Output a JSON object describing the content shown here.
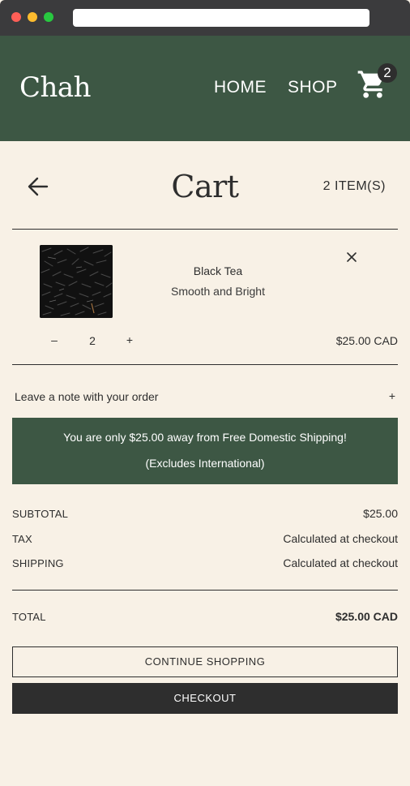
{
  "header": {
    "logo": "Chah",
    "nav": [
      "HOME",
      "SHOP"
    ],
    "cart_count": "2",
    "colors": {
      "header_bg": "#3d5744",
      "page_bg": "#f8f1e6",
      "dark": "#2e2e2e"
    }
  },
  "cart": {
    "title": "Cart",
    "item_count_label": "2 ITEM(S)",
    "icons": {
      "back": "arrow-left-icon",
      "cart": "shopping-cart-icon",
      "remove": "close-icon"
    }
  },
  "items": [
    {
      "name": "Black Tea",
      "subtitle": "Smooth and Bright",
      "quantity": "2",
      "minus": "–",
      "plus": "+",
      "price": "$25.00 CAD"
    }
  ],
  "note": {
    "label": "Leave a note with your order",
    "toggle": "+"
  },
  "shipping_banner": {
    "line1": "You are only $25.00 away from Free Domestic Shipping!",
    "line2": "(Excludes International)"
  },
  "summary": {
    "subtotal_label": "SUBTOTAL",
    "subtotal_value": "$25.00",
    "tax_label": "TAX",
    "tax_value": "Calculated at checkout",
    "shipping_label": "SHIPPING",
    "shipping_value": "Calculated at checkout",
    "total_label": "TOTAL",
    "total_value": "$25.00 CAD"
  },
  "buttons": {
    "continue_shopping": "CONTINUE SHOPPING",
    "checkout": "CHECKOUT"
  }
}
